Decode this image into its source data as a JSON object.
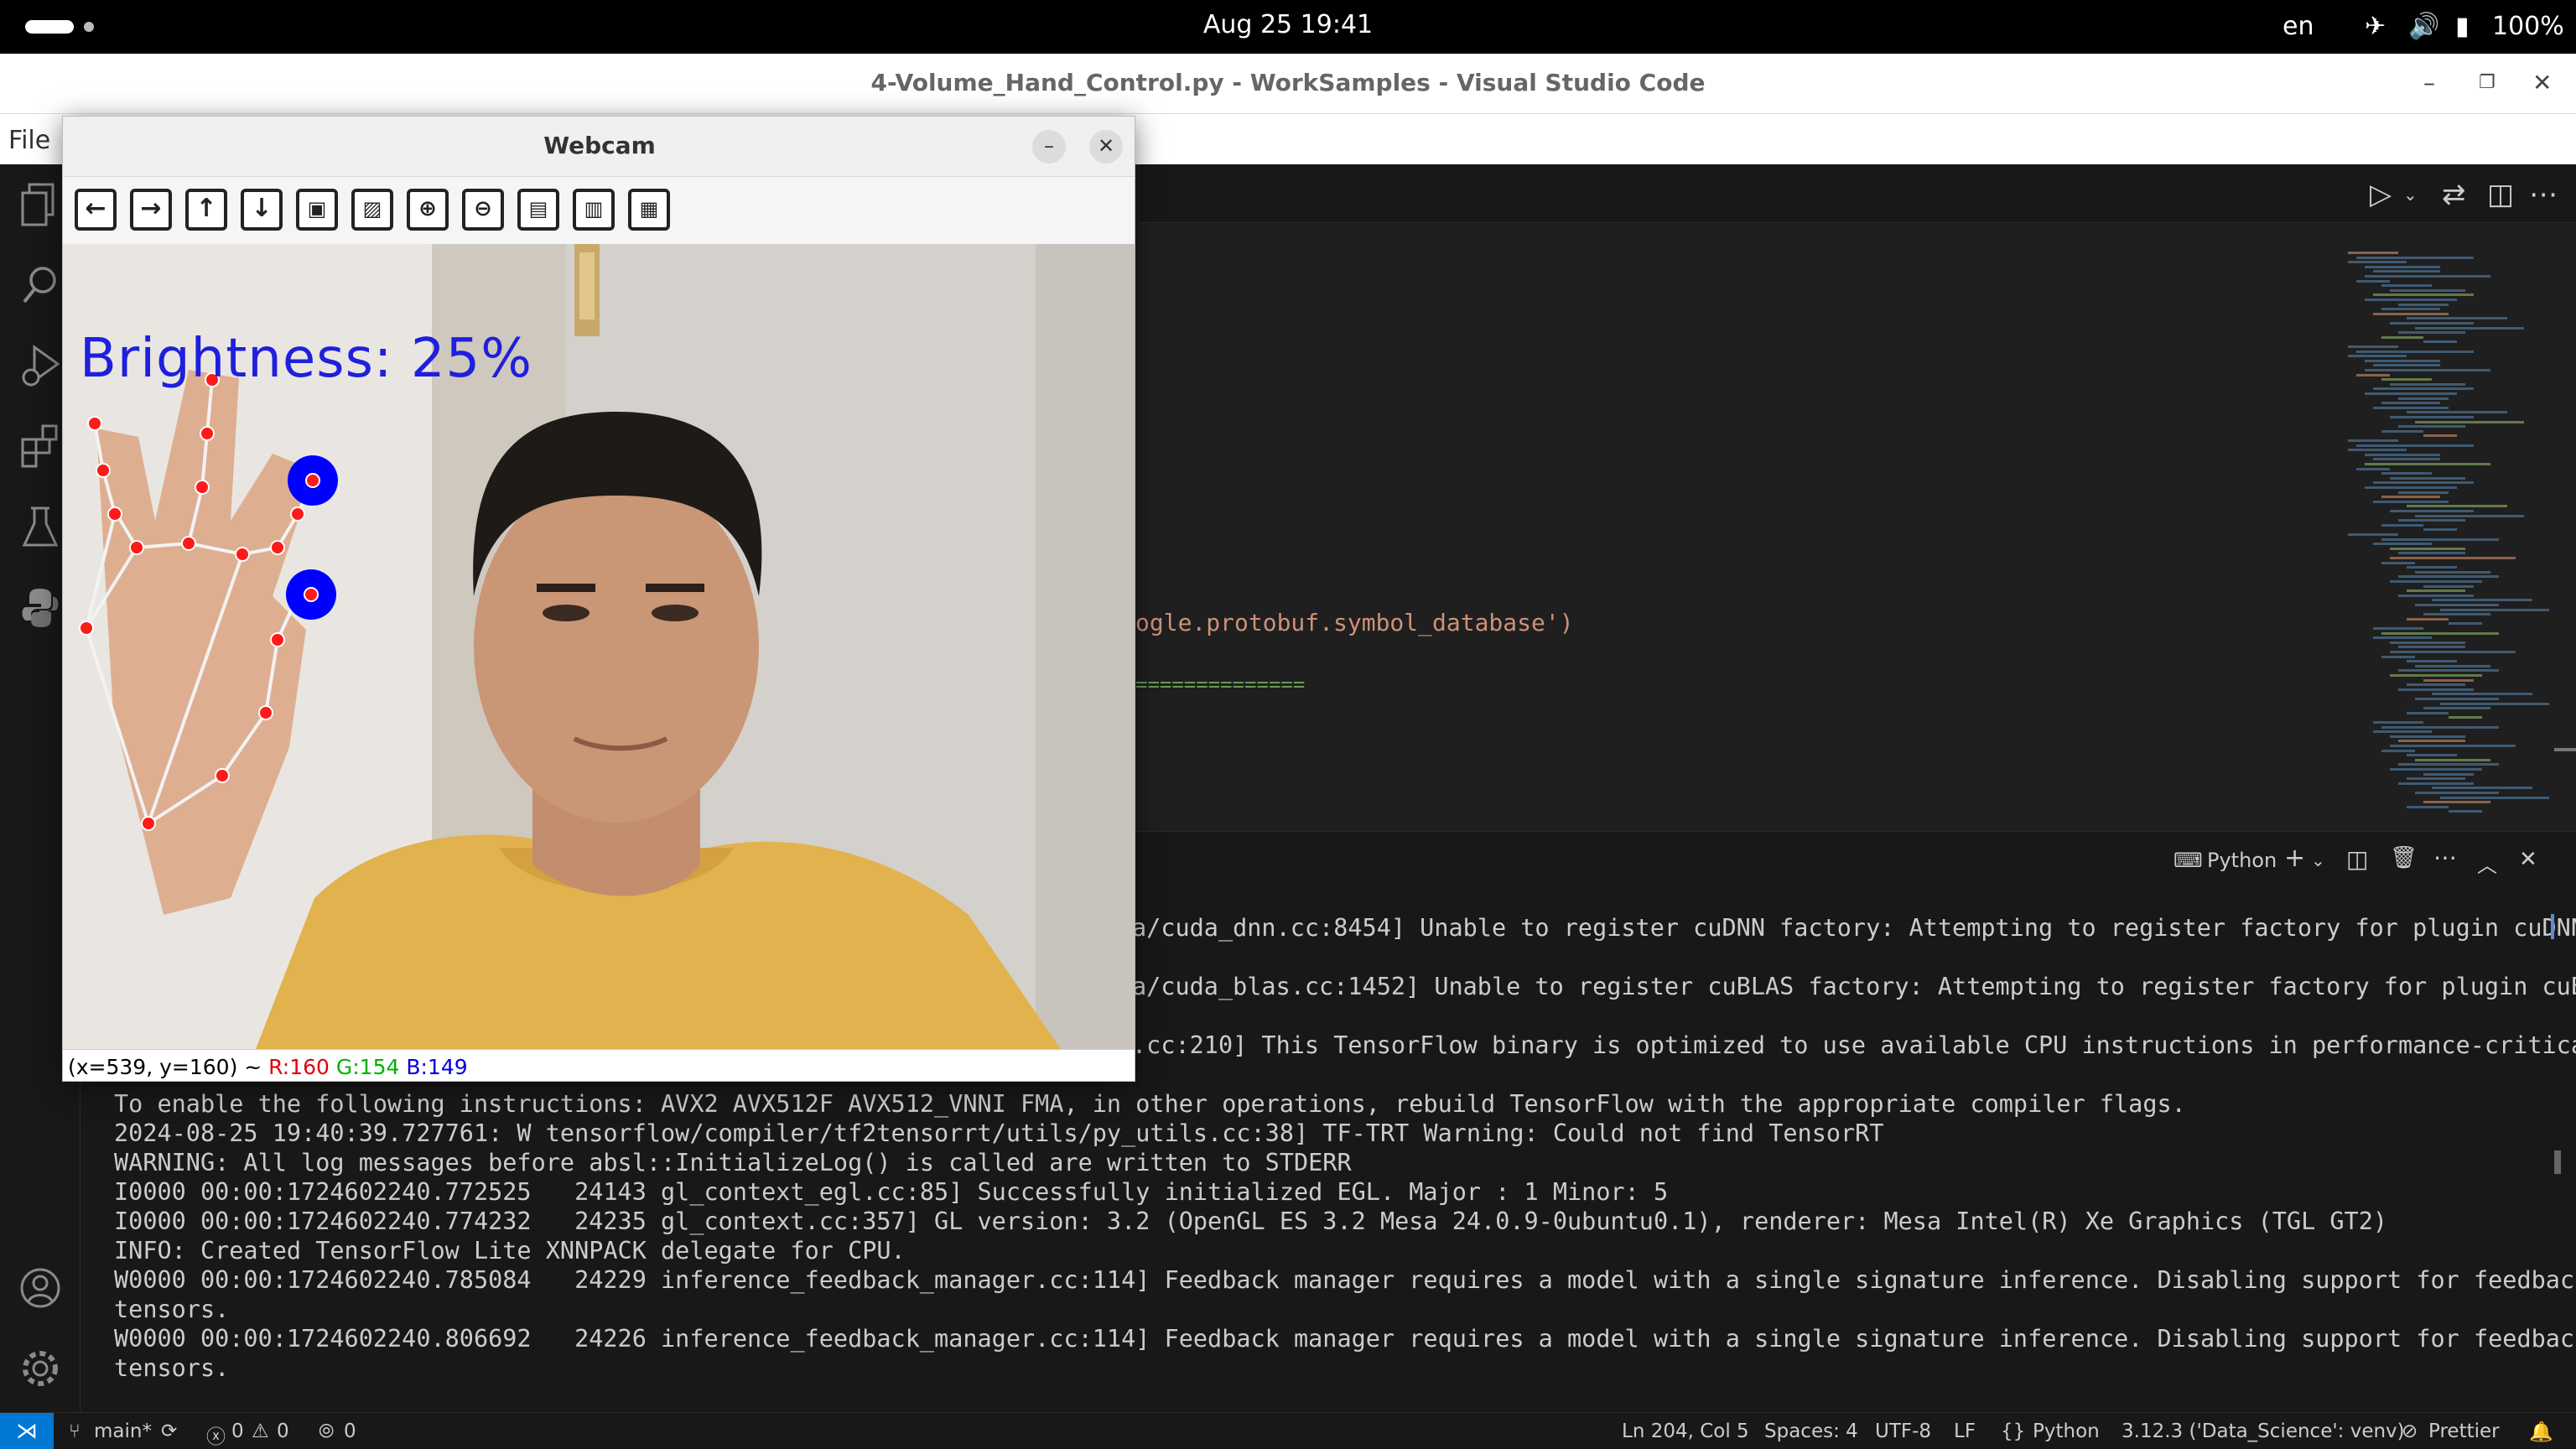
{
  "os": {
    "clock": "Aug 25  19:41",
    "language": "en",
    "battery": "100%"
  },
  "vscode": {
    "window_title": "4-Volume_Hand_Control.py - WorkSamples - Visual Studio Code",
    "menu_file": "File",
    "code_lines": [
      "ogle.protobuf.symbol_database')",
      "=============="
    ],
    "panel": {
      "shell_label": "Python"
    },
    "terminal_lines": [
      "a/cuda_dnn.cc:8454] Unable to register cuDNN factory: Attempting to register factory for plugin cuDNN",
      "a/cuda_blas.cc:1452] Unable to register cuBLAS factory: Attempting to register factory for plugin cuB",
      ".cc:210] This TensorFlow binary is optimized to use available CPU instructions in performance-critica",
      "To enable the following instructions: AVX2 AVX512F AVX512_VNNI FMA, in other operations, rebuild TensorFlow with the appropriate compiler flags.",
      "2024-08-25 19:40:39.727761: W tensorflow/compiler/tf2tensorrt/utils/py_utils.cc:38] TF-TRT Warning: Could not find TensorRT",
      "WARNING: All log messages before absl::InitializeLog() is called are written to STDERR",
      "I0000 00:00:1724602240.772525   24143 gl_context_egl.cc:85] Successfully initialized EGL. Major : 1 Minor: 5",
      "I0000 00:00:1724602240.774232   24235 gl_context.cc:357] GL version: 3.2 (OpenGL ES 3.2 Mesa 24.0.9-0ubuntu0.1), renderer: Mesa Intel(R) Xe Graphics (TGL GT2)",
      "INFO: Created TensorFlow Lite XNNPACK delegate for CPU.",
      "W0000 00:00:1724602240.785084   24229 inference_feedback_manager.cc:114] Feedback manager requires a model with a single signature inference. Disabling support for feedback",
      "tensors.",
      "W0000 00:00:1724602240.806692   24226 inference_feedback_manager.cc:114] Feedback manager requires a model with a single signature inference. Disabling support for feedback",
      "tensors."
    ],
    "status": {
      "branch": "main*",
      "errors": "0",
      "warnings": "0",
      "ports": "0",
      "position": "Ln 204, Col 5",
      "spaces": "Spaces: 4",
      "encoding": "UTF-8",
      "eol": "LF",
      "language": "Python",
      "interpreter": "3.12.3 ('Data_Science': venv)",
      "formatter": "Prettier"
    }
  },
  "webcam": {
    "title": "Webcam",
    "overlay_text": "Brightness: 25%",
    "brightness_percent": 25,
    "status_coords": "(x=539, y=160) ~",
    "status_r": "R:160",
    "status_g": "G:154",
    "status_b": "B:149",
    "toolbar": [
      "pan-left",
      "pan-right",
      "pan-up",
      "pan-down",
      "zoom-fit",
      "zoom-original",
      "zoom-in",
      "zoom-out",
      "save",
      "copy",
      "properties"
    ]
  },
  "colors": {
    "vscode_blue": "#0078d4",
    "landmark_red": "#ff1a1a",
    "fingertip_blue": "#0000ff",
    "overlay_text_blue": "#1f1fdd",
    "code_orange": "#ce9178",
    "code_green": "#6a9955"
  }
}
